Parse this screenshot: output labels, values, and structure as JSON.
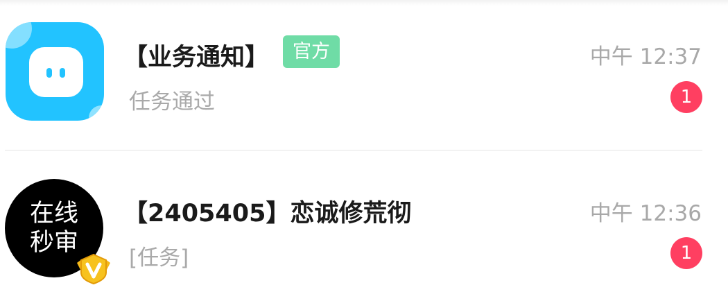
{
  "messages": [
    {
      "title": "【业务通知】",
      "badge": "官方",
      "time": "中午 12:37",
      "preview": "任务通过",
      "unread": "1",
      "avatar_icon": "chat-app-icon"
    },
    {
      "title": "【2405405】恋诚修荒彻",
      "time": "中午 12:36",
      "preview": "[任务]",
      "unread": "1",
      "avatar_text": [
        "在线",
        "秒审"
      ],
      "verified_icon": "v-badge-icon"
    }
  ],
  "colors": {
    "app_icon_bg": "#22c3ff",
    "official_badge": "#6fdca6",
    "unread_badge": "#ff3f61",
    "verified_badge": "#f5b818"
  }
}
